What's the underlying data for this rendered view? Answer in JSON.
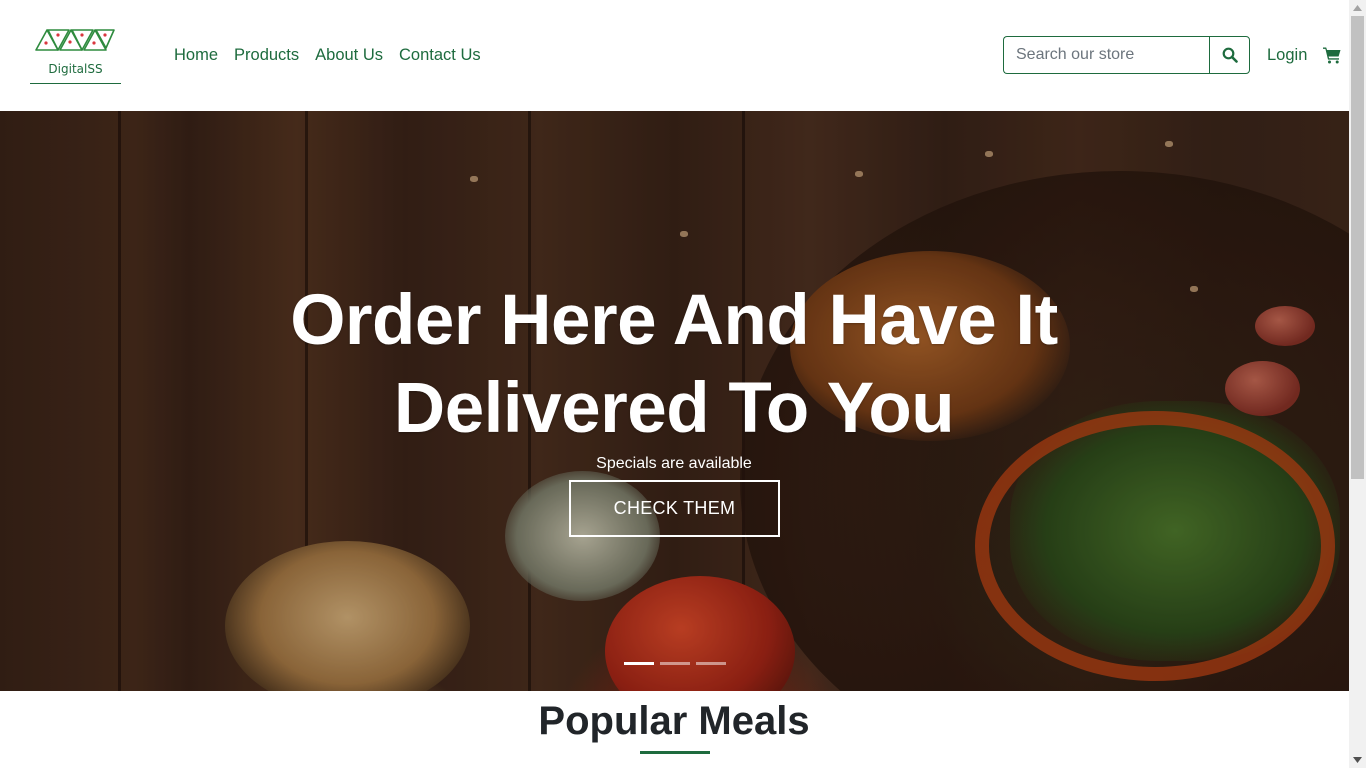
{
  "brand": {
    "logo_text": "DigitalSS",
    "color": "#1e6b3e"
  },
  "nav": {
    "items": [
      {
        "label": "Home"
      },
      {
        "label": "Products"
      },
      {
        "label": "About Us"
      },
      {
        "label": "Contact Us"
      }
    ]
  },
  "search": {
    "placeholder": "Search our store",
    "value": "",
    "icon": "search-icon"
  },
  "account": {
    "login_label": "Login",
    "cart_icon": "cart-icon"
  },
  "hero": {
    "title": "Order Here And Have It Delivered To You",
    "subtitle": "Specials are available",
    "button_label": "CHECK THEM",
    "slide_count": 3,
    "active_slide": 1
  },
  "section": {
    "title": "Popular Meals"
  }
}
